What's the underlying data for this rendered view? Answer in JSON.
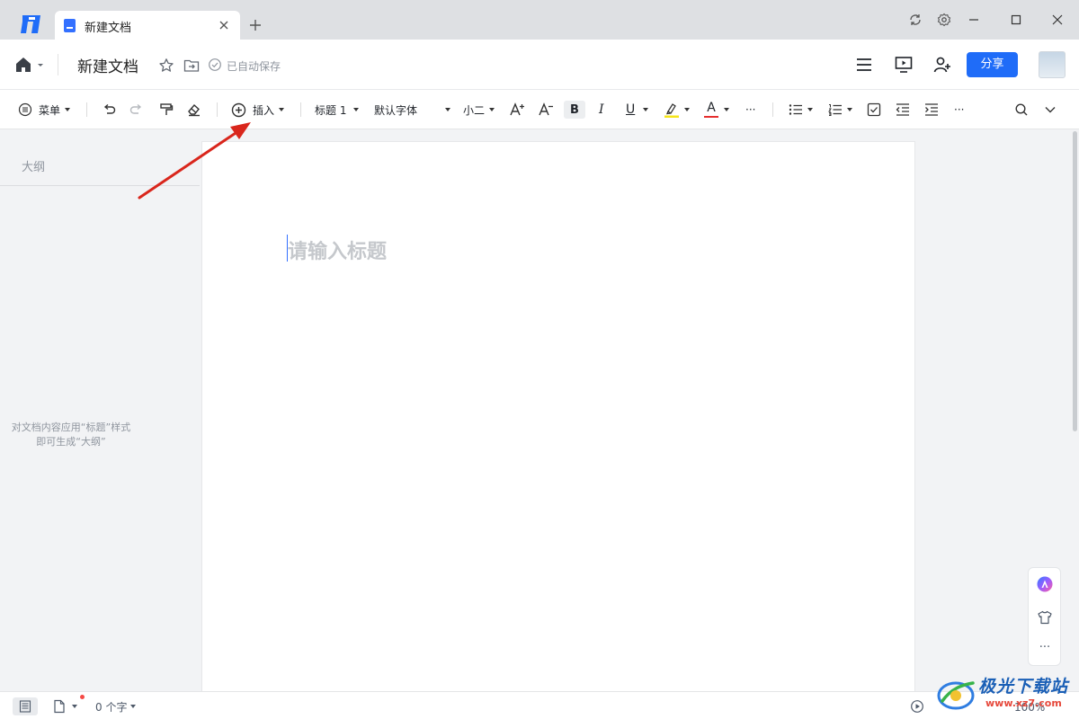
{
  "titlebar": {
    "tab_title": "新建文档",
    "icons": [
      "app-logo-icon",
      "doc-icon",
      "close-icon",
      "plus-icon",
      "sync-icon",
      "gear-icon",
      "minimize-icon",
      "maximize-icon",
      "window-close-icon"
    ]
  },
  "header": {
    "doc_title": "新建文档",
    "save_status": "已自动保存",
    "share_label": "分享",
    "icons": [
      "home-icon",
      "star-icon",
      "move-icon",
      "check-circle-icon",
      "menu-icon",
      "present-icon",
      "add-user-icon"
    ]
  },
  "toolbar": {
    "menu_label": "菜单",
    "insert_label": "插入",
    "heading_style": "标题 1",
    "font_family": "默认字体",
    "font_size": "小二",
    "bold_glyph": "B",
    "italic_glyph": "I",
    "underline_glyph": "U",
    "font_color_glyph": "A",
    "highlight_color": "#f5e51a",
    "font_color": "#e62e2e",
    "more_glyph": "···"
  },
  "outline": {
    "title": "大纲",
    "hint_line1": "对文档内容应用“标题”样式",
    "hint_line2": "即可生成“大纲”"
  },
  "page": {
    "title_placeholder": "请输入标题"
  },
  "float_panel": {
    "more_glyph": "···"
  },
  "statusbar": {
    "word_count": "0 个字",
    "zoom": "100%"
  },
  "watermark": {
    "text": "极光下载站",
    "url": "www.xz7.com"
  },
  "colors": {
    "accent": "#1f6cf8",
    "annotation_arrow": "#d9261c"
  }
}
